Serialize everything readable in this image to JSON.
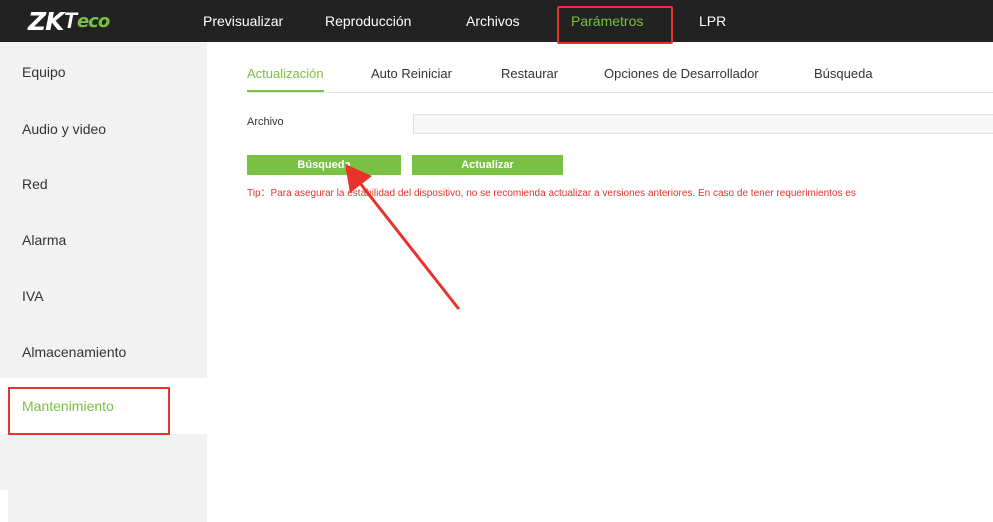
{
  "logo": {
    "brand": "ZK",
    "suffix_t": "T",
    "suffix_rest": "eco"
  },
  "nav": {
    "items": [
      {
        "label": "Previsualizar"
      },
      {
        "label": "Reproducción"
      },
      {
        "label": "Archivos"
      },
      {
        "label": "Parámetros",
        "active": true
      },
      {
        "label": "LPR"
      }
    ]
  },
  "sidebar": {
    "items": [
      {
        "label": "Equipo"
      },
      {
        "label": "Audio y video"
      },
      {
        "label": "Red"
      },
      {
        "label": "Alarma"
      },
      {
        "label": "IVA"
      },
      {
        "label": "Almacenamiento"
      },
      {
        "label": "Mantenimiento",
        "active": true
      }
    ]
  },
  "tabs": [
    {
      "label": "Actualización",
      "active": true
    },
    {
      "label": "Auto Reiniciar"
    },
    {
      "label": "Restaurar"
    },
    {
      "label": "Opciones de Desarrollador"
    },
    {
      "label": "Búsqueda"
    }
  ],
  "form": {
    "file_label": "Archivo",
    "file_value": "",
    "search_button": "Búsqueda",
    "update_button": "Actualizar",
    "tip": "Tip：Para asegurar la estabilidad del dispositivo,    no se recomienda actualizar a versiones anteriores. En caso de tener requerimientos es"
  },
  "colors": {
    "accent": "#7ac143",
    "topbar": "#222222",
    "highlight": "#e8322e",
    "tip": "#e8322e"
  }
}
